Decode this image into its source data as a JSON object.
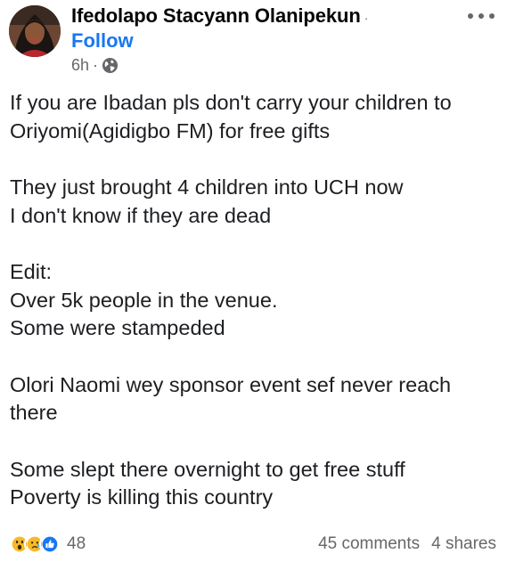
{
  "post": {
    "author": "Ifedolapo Stacyann Olanipekun",
    "author_separator": "·",
    "follow_label": "Follow",
    "time": "6h",
    "time_separator": "·",
    "audience_icon": "globe-icon",
    "more_icon": "more-horizontal-icon",
    "paragraphs": [
      {
        "lines": [
          "If you are Ibadan pls don't carry your children to",
          "Oriyomi(Agidigbo FM) for free gifts"
        ]
      },
      {
        "lines": [
          "They just brought 4 children into UCH now",
          "I don't know if they are dead"
        ]
      },
      {
        "lines": [
          "Edit:",
          "Over 5k people in the venue.",
          "Some were stampeded"
        ]
      },
      {
        "lines": [
          "Olori Naomi wey sponsor event sef never reach",
          "there"
        ]
      },
      {
        "lines": [
          "Some slept there overnight to get free stuff",
          "Poverty is killing this country"
        ]
      }
    ]
  },
  "footer": {
    "reaction_icons": [
      "wow-reaction-icon",
      "sad-reaction-icon",
      "like-reaction-icon"
    ],
    "reaction_count": "48",
    "comments": "45 comments",
    "shares": "4 shares"
  },
  "colors": {
    "link": "#1877f2",
    "text": "#1c1e21",
    "secondary": "#65676b"
  }
}
